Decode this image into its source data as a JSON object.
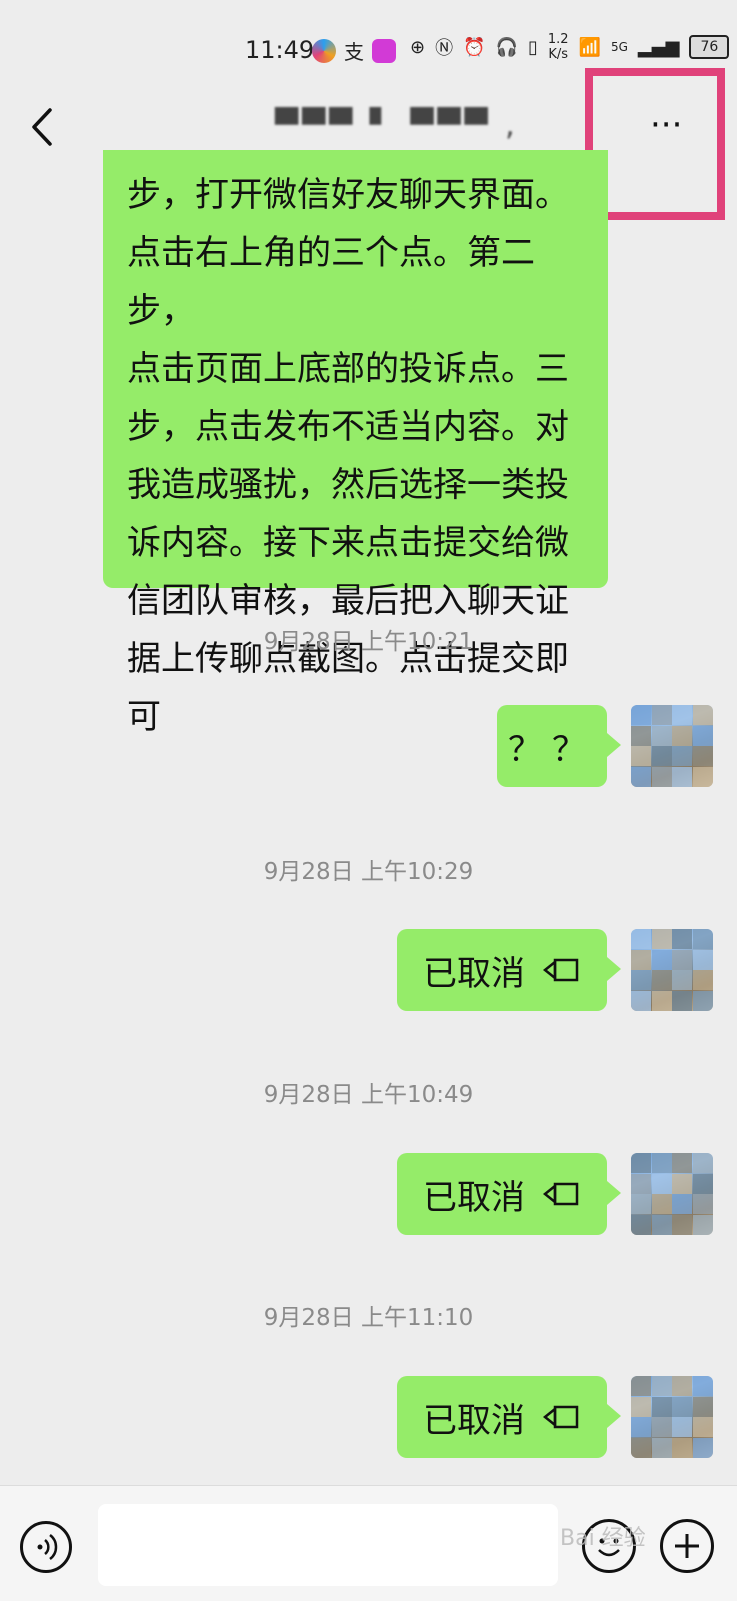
{
  "status_bar": {
    "time": "11:49",
    "speed_value": "1.2",
    "speed_unit": "K/s",
    "network": "5G",
    "battery": "76"
  },
  "header": {
    "title": "▀▀▀ ▘ ▀▀▀ ,",
    "more_label": "···"
  },
  "colors": {
    "bubble": "#95ec69",
    "highlight": "#e0427a",
    "background": "#ededed"
  },
  "messages": {
    "long_text_lines": [
      "步，打开微信好友聊天界面。",
      "点击右上角的三个点。第二步，",
      "点击页面上底部的投诉点。三",
      "步，点击发布不适当内容。对",
      "我造成骚扰，然后选择一类投",
      "诉内容。接下来点击提交给微",
      "信团队审核，最后把入聊天证",
      "据上传聊点截图。点击提交即",
      "可"
    ],
    "time_1": "9月28日 上午10:21",
    "text_qq": "？？",
    "time_2": "9月28日 上午10:29",
    "cancel_1": "已取消",
    "time_3": "9月28日 上午10:49",
    "cancel_2": "已取消",
    "time_4": "9月28日 上午11:10",
    "cancel_3": "已取消"
  },
  "icons": {
    "back": "back-icon",
    "more": "more-icon",
    "camera": "video-call-icon",
    "voice": "voice-icon",
    "emoji": "emoji-icon",
    "plus": "plus-icon"
  },
  "watermark": "Bai 经验"
}
